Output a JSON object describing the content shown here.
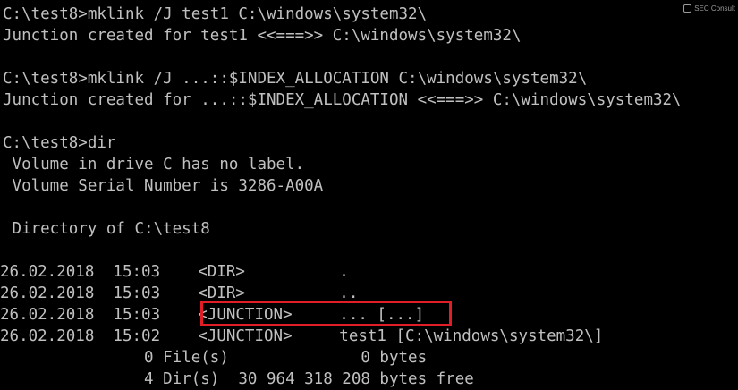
{
  "watermark": {
    "text": "SEC Consult",
    "icon": "sec-consult-logo"
  },
  "console": {
    "lines": [
      "C:\\test8>mklink /J test1 C:\\windows\\system32\\",
      "Junction created for test1 <<===>> C:\\windows\\system32\\",
      "",
      "C:\\test8>mklink /J ...::$INDEX_ALLOCATION C:\\windows\\system32\\",
      "Junction created for ...::$INDEX_ALLOCATION <<===>> C:\\windows\\system32\\",
      "",
      "C:\\test8>dir",
      " Volume in drive C has no label.",
      " Volume Serial Number is 3286-A00A",
      "",
      " Directory of C:\\test8",
      "",
      "26.02.2018  15:03    <DIR>          .",
      "26.02.2018  15:03    <DIR>          ..",
      "26.02.2018  15:03    <JUNCTION>     ... [...]",
      "26.02.2018  15:02    <JUNCTION>     test1 [C:\\windows\\system32\\]",
      "               0 File(s)              0 bytes",
      "               4 Dir(s)  30 964 318 208 bytes free"
    ]
  },
  "highlight": {
    "color": "#e11e26",
    "target": "junction-entry-hidden"
  }
}
